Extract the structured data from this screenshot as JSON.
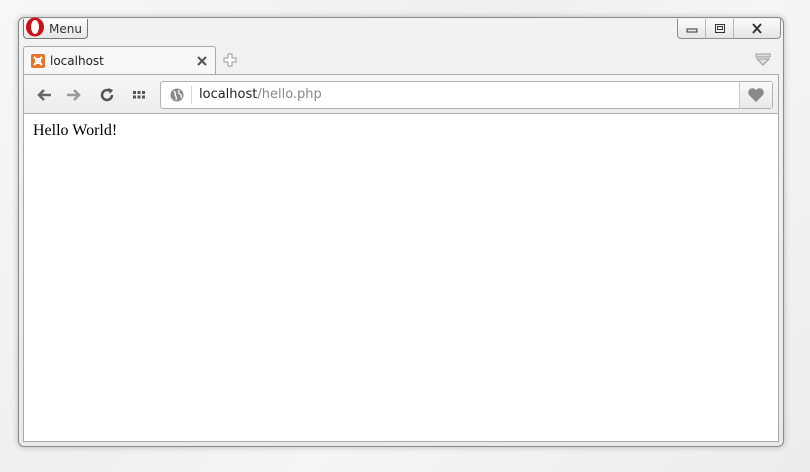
{
  "menu": {
    "label": "Menu"
  },
  "tab": {
    "title": "localhost",
    "favicon": "xampp-icon",
    "favicon_color": "#e8732a"
  },
  "address": {
    "host": "localhost",
    "path": "/hello.php"
  },
  "page": {
    "text": "Hello World!"
  },
  "icons": {
    "back": "arrow-left-icon",
    "forward": "arrow-right-icon",
    "reload": "reload-icon",
    "speeddial": "grid-icon",
    "site_info": "globe-icon",
    "bookmark": "heart-icon",
    "new_tab": "plus-icon",
    "tab_menu": "tab-menu-icon"
  }
}
